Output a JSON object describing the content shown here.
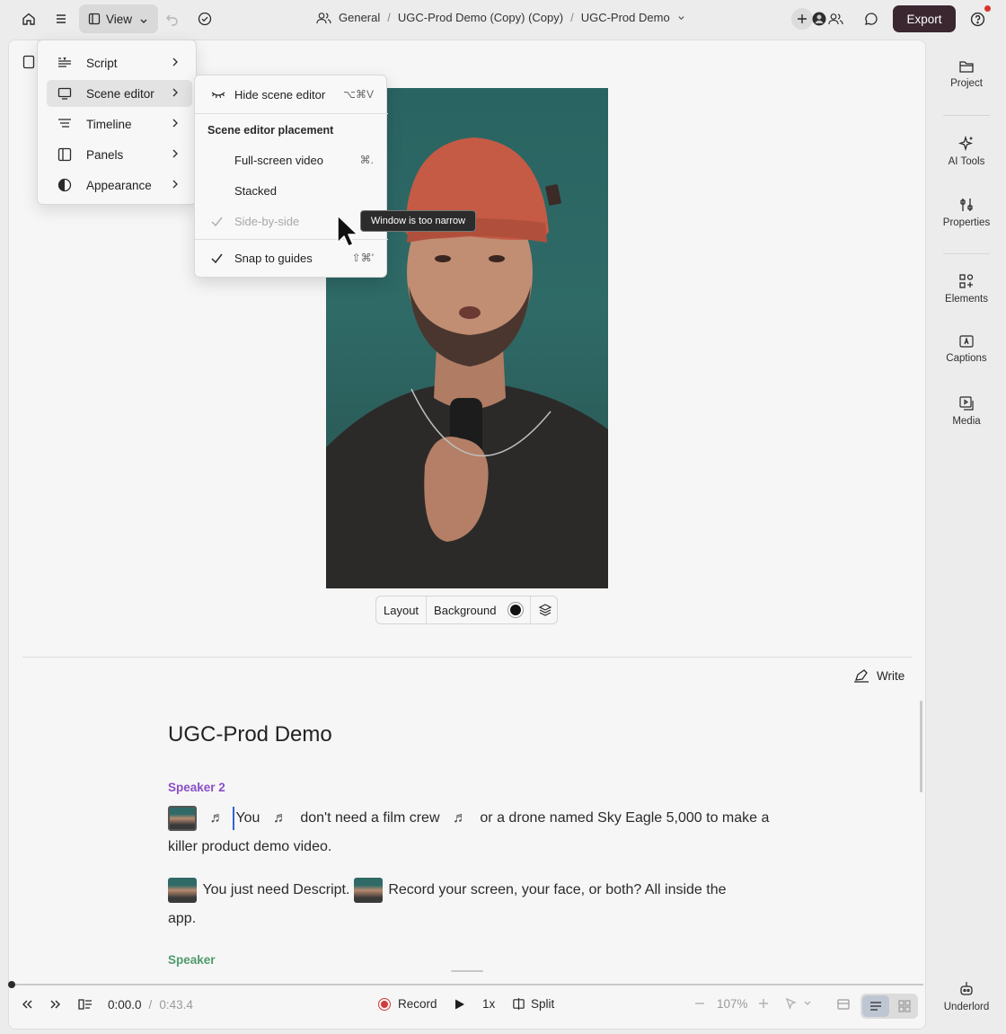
{
  "topbar": {
    "view_label": "View",
    "breadcrumb": [
      "General",
      "UGC-Prod Demo (Copy) (Copy)",
      "UGC-Prod Demo"
    ],
    "export_label": "Export"
  },
  "view_menu": {
    "items": [
      {
        "label": "Script",
        "icon": "script-icon"
      },
      {
        "label": "Scene editor",
        "icon": "monitor-icon"
      },
      {
        "label": "Timeline",
        "icon": "timeline-icon"
      },
      {
        "label": "Panels",
        "icon": "panels-icon"
      },
      {
        "label": "Appearance",
        "icon": "contrast-icon"
      }
    ],
    "active": "Scene editor"
  },
  "scene_menu": {
    "hide_label": "Hide scene editor",
    "hide_shortcut": "⌥⌘V",
    "placement_header": "Scene editor placement",
    "fullscreen_label": "Full-screen video",
    "fullscreen_shortcut": "⌘.",
    "stacked_label": "Stacked",
    "side_label": "Side-by-side",
    "snap_label": "Snap to guides",
    "snap_shortcut": "⇧⌘'"
  },
  "tooltip": "Window is too narrow",
  "canvas_toolbar": {
    "layout_label": "Layout",
    "background_label": "Background"
  },
  "write_label": "Write",
  "script": {
    "title": "UGC-Prod Demo",
    "speaker1": "Speaker 2",
    "speaker1_color": "#8a4fc7",
    "line1_a": "You",
    "line1_b": "don't need a film crew",
    "line1_c": "or a drone named Sky Eagle 5,000 to make a",
    "line1_d": "killer product demo video.",
    "line2_a": "You just need Descript.",
    "line2_b": "Record your screen, your face, or both? All inside the",
    "line2_c": "app.",
    "speaker2": "Speaker",
    "speaker2_color": "#4f9a6e",
    "note": "♬"
  },
  "bottombar": {
    "time_current": "0:00.0",
    "time_sep": "/",
    "time_total": "0:43.4",
    "record_label": "Record",
    "speed": "1x",
    "split_label": "Split",
    "zoom": "107%"
  },
  "right_sidebar": {
    "items": [
      "Project",
      "AI Tools",
      "Properties",
      "Elements",
      "Captions",
      "Media",
      "Underlord"
    ]
  },
  "colors": {
    "export_bg": "#3a2730",
    "accent": "#2d63d8",
    "record": "#d23b3b"
  }
}
